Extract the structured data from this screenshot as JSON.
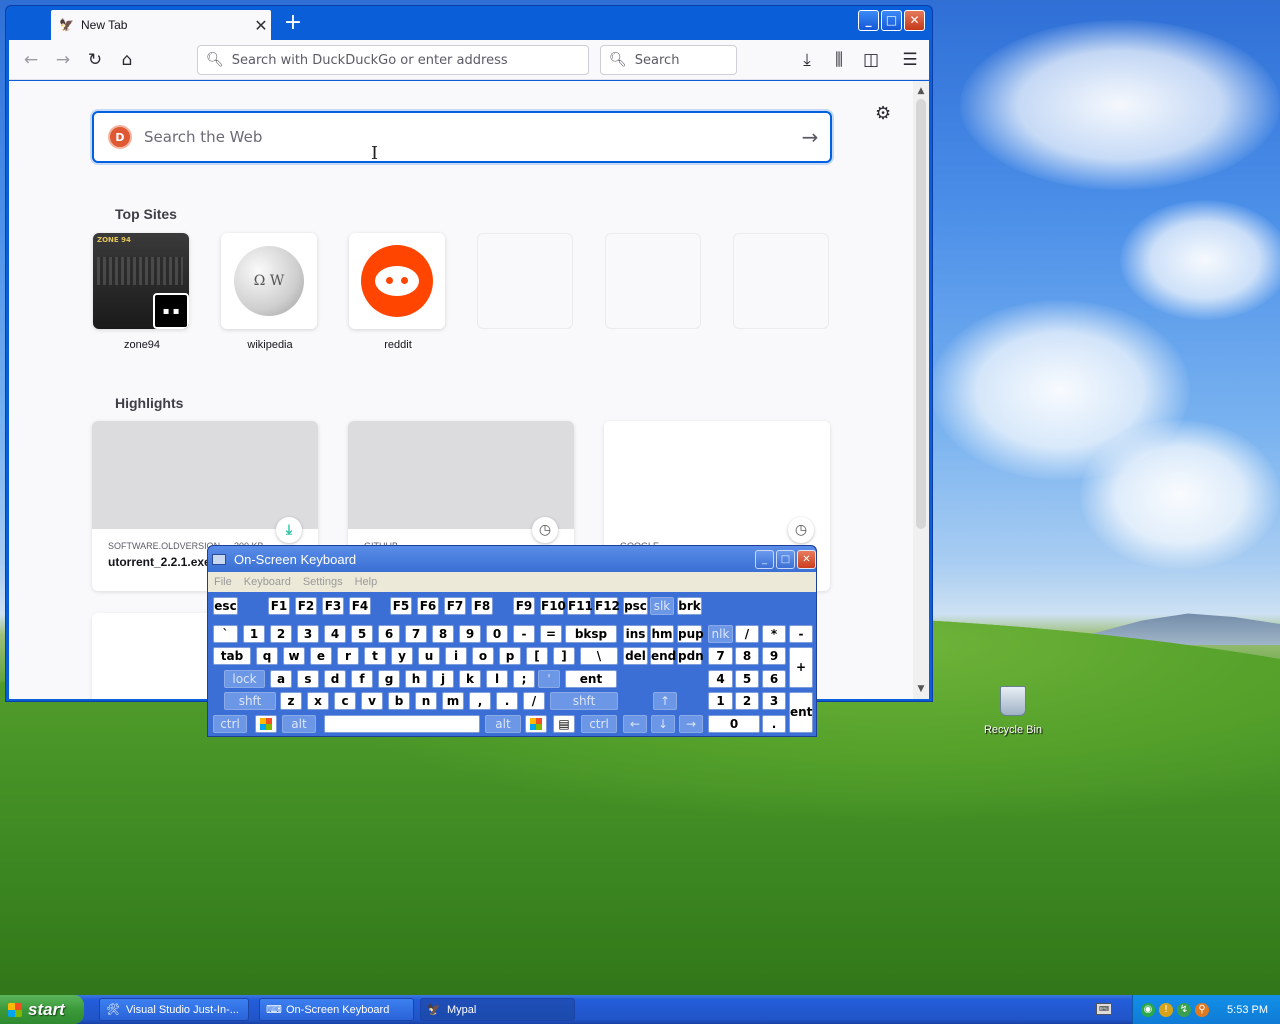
{
  "browser": {
    "tab": {
      "title": "New Tab",
      "favicon": "mypal-icon"
    },
    "window_buttons": {
      "minimize": "_",
      "maximize": "□",
      "close": "✕"
    },
    "toolbar": {
      "url_placeholder": "Search with DuckDuckGo or enter address",
      "search_placeholder": "Search"
    },
    "newtab": {
      "websearch_placeholder": "Search the Web",
      "top_sites_title": "Top Sites",
      "top_sites": [
        {
          "label": "zone94",
          "icon": "zone94-thumbnail"
        },
        {
          "label": "wikipedia",
          "icon": "wikipedia-globe-icon"
        },
        {
          "label": "reddit",
          "icon": "reddit-icon"
        },
        {
          "label": ""
        },
        {
          "label": ""
        },
        {
          "label": ""
        }
      ],
      "highlights_title": "Highlights",
      "highlights": [
        {
          "source": "SOFTWARE.OLDVERSION",
          "size": "300 KB",
          "title": "utorrent_2.2.1.exe",
          "badge": "download-icon"
        },
        {
          "source": "GITHUB",
          "size": "",
          "title": "",
          "badge": "clock-icon"
        },
        {
          "source": "GOOGLE",
          "size": "",
          "title": "",
          "badge": "clock-icon"
        }
      ]
    }
  },
  "osk": {
    "title": "On-Screen Keyboard",
    "menu": [
      "File",
      "Keyboard",
      "Settings",
      "Help"
    ],
    "rows": {
      "r1": [
        "esc",
        "F1",
        "F2",
        "F3",
        "F4",
        "F5",
        "F6",
        "F7",
        "F8",
        "F9",
        "F10",
        "F11",
        "F12",
        "psc",
        "slk",
        "brk"
      ],
      "r2": [
        "`",
        "1",
        "2",
        "3",
        "4",
        "5",
        "6",
        "7",
        "8",
        "9",
        "0",
        "-",
        "=",
        "bksp",
        "ins",
        "hm",
        "pup",
        "nlk",
        "/",
        "*",
        "-"
      ],
      "r3": [
        "tab",
        "q",
        "w",
        "e",
        "r",
        "t",
        "y",
        "u",
        "i",
        "o",
        "p",
        "[",
        "]",
        "\\",
        "del",
        "end",
        "pdn",
        "7",
        "8",
        "9",
        "+"
      ],
      "r4": [
        "lock",
        "a",
        "s",
        "d",
        "f",
        "g",
        "h",
        "j",
        "k",
        "l",
        ";",
        "'",
        "ent",
        "4",
        "5",
        "6"
      ],
      "r5": [
        "shft",
        "z",
        "x",
        "c",
        "v",
        "b",
        "n",
        "m",
        ",",
        ".",
        "/",
        "shft",
        "↑",
        "1",
        "2",
        "3",
        "ent"
      ],
      "r6": [
        "ctrl",
        "win",
        "alt",
        "",
        "alt",
        "win",
        "menu",
        "ctrl",
        "←",
        "↓",
        "→",
        "0",
        "."
      ]
    }
  },
  "desktop": {
    "recycle_bin": "Recycle Bin"
  },
  "taskbar": {
    "start": "start",
    "tasks": [
      {
        "label": "Visual Studio Just-In-...",
        "icon": "vs-jit-icon"
      },
      {
        "label": "On-Screen Keyboard",
        "icon": "keyboard-icon"
      },
      {
        "label": "Mypal",
        "icon": "mypal-icon"
      }
    ],
    "clock": "5:53 PM"
  }
}
